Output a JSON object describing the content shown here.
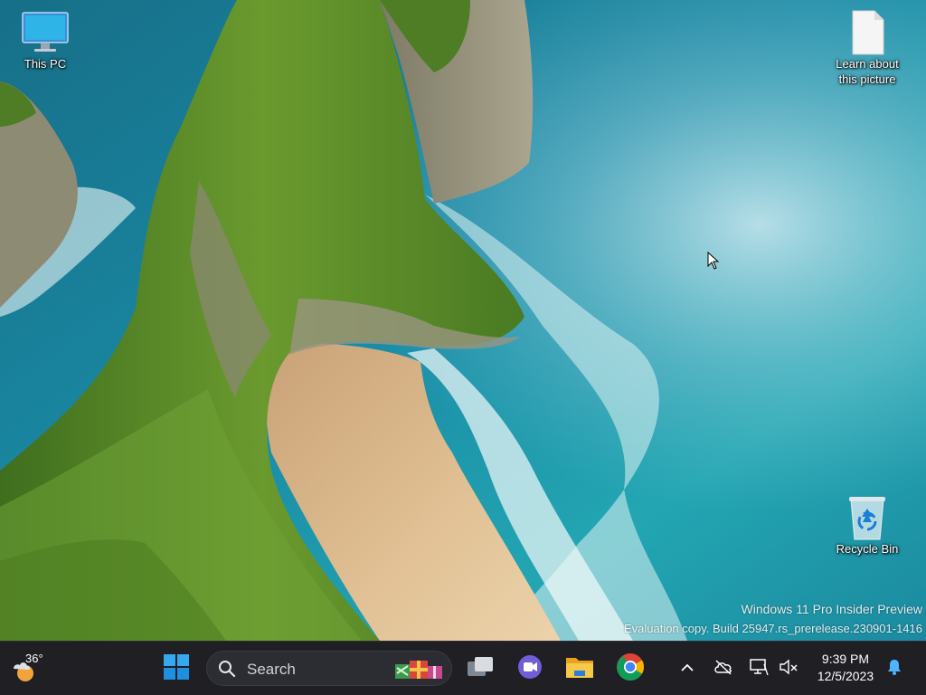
{
  "desktop": {
    "icons": [
      {
        "label": "This PC",
        "icon": "monitor-icon"
      },
      {
        "label": "Learn about this picture",
        "icon": "document-icon"
      },
      {
        "label": "Recycle Bin",
        "icon": "recycle-bin-icon"
      }
    ],
    "watermark": {
      "line1": "Windows 11 Pro Insider Preview",
      "line2": "Evaluation copy. Build 25947.rs_prerelease.230901-1416"
    }
  },
  "taskbar": {
    "weather": {
      "temperature": "36°",
      "icon": "partly-cloudy-icon"
    },
    "start": {
      "icon": "windows-logo-icon"
    },
    "search": {
      "placeholder": "Search",
      "icon": "search-icon",
      "highlight": "gift-boxes-icon"
    },
    "apps": [
      {
        "name": "Task View",
        "icon": "task-view-icon"
      },
      {
        "name": "Meet",
        "icon": "video-chat-icon"
      },
      {
        "name": "File Explorer",
        "icon": "folder-icon"
      },
      {
        "name": "Chrome",
        "icon": "chrome-icon"
      }
    ],
    "tray": {
      "overflow_icon": "chevron-up-icon",
      "icons": [
        "cloud-offline-icon",
        "network-icon",
        "volume-muted-icon"
      ],
      "time": "9:39 PM",
      "date": "12/5/2023",
      "notification_icon": "bell-icon"
    }
  },
  "colors": {
    "taskbar_bg": "#1f1f24",
    "sea": "#1e8ea6",
    "sand": "#d9b98a",
    "cliff_green": "#5e8a2a"
  }
}
